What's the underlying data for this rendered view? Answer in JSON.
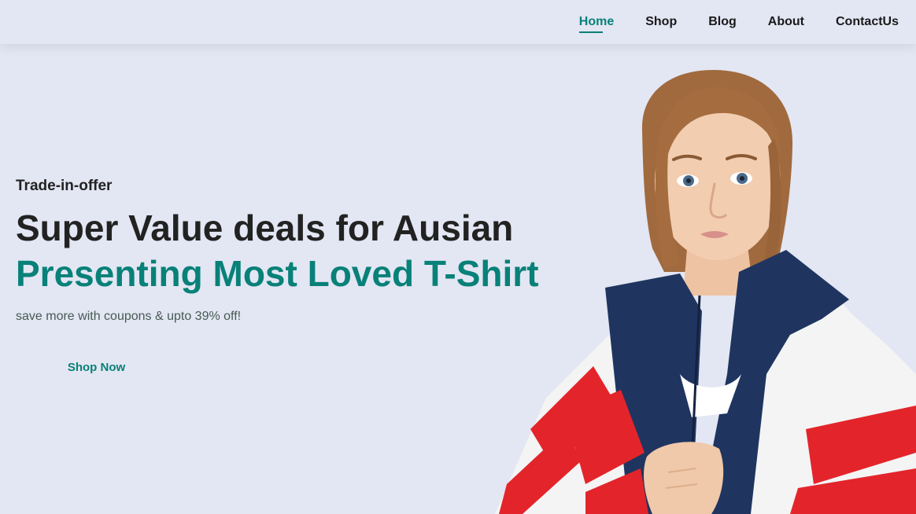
{
  "nav": {
    "items": [
      {
        "label": "Home",
        "active": true
      },
      {
        "label": "Shop",
        "active": false
      },
      {
        "label": "Blog",
        "active": false
      },
      {
        "label": "About",
        "active": false
      },
      {
        "label": "ContactUs",
        "active": false
      }
    ]
  },
  "hero": {
    "eyebrow": "Trade-in-offer",
    "headline": "Super Value deals for Ausian",
    "subheadline": "Presenting Most Loved T-Shirt",
    "body": "save more with coupons & upto 39% off!",
    "cta_label": "Shop Now",
    "image": "model-in-windbreaker-jacket"
  },
  "colors": {
    "accent": "#088178",
    "background": "#e3e6f3",
    "text": "#222222"
  }
}
